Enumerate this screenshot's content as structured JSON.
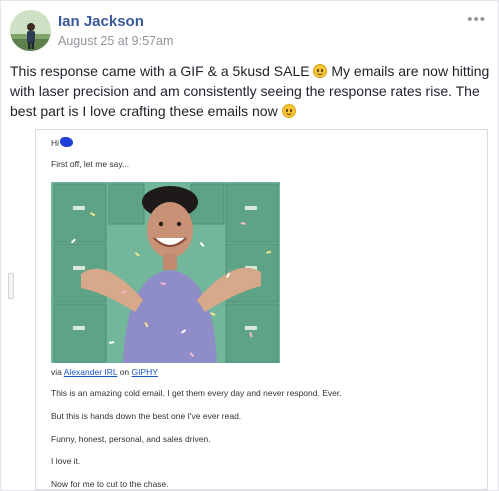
{
  "post": {
    "author": "Ian Jackson",
    "timestamp": "August 25 at 9:57am",
    "more_icon": "more-icon",
    "text_parts": [
      "This response came with a GIF & a 5kusd SALE ",
      " My emails are now hitting with laser precision and am consistently seeing the response rates rise. The best part is I love crafting these emails now "
    ],
    "emoji": "smiley-emoji-icon"
  },
  "email": {
    "greeting": "Hi",
    "line_intro": "First off, let me say...",
    "gif_alt": "GIF of a man clapping with confetti",
    "via_prefix": "via ",
    "via_author": "Alexander IRL",
    "via_on": " on ",
    "via_source": "GIPHY",
    "lines": [
      "This is an amazing cold email. I get them every day and never respond. Ever.",
      "But this is hands down the best one I've ever read.",
      "Funny, honest, personal, and sales driven.",
      "I love it.",
      "Now for me to cut to the chase."
    ]
  },
  "colors": {
    "author_link": "#385898",
    "meta_gray": "#90949c",
    "email_link": "#1a54c8",
    "gif_background": "#6fb39a",
    "shirt": "#8f8dc8"
  }
}
